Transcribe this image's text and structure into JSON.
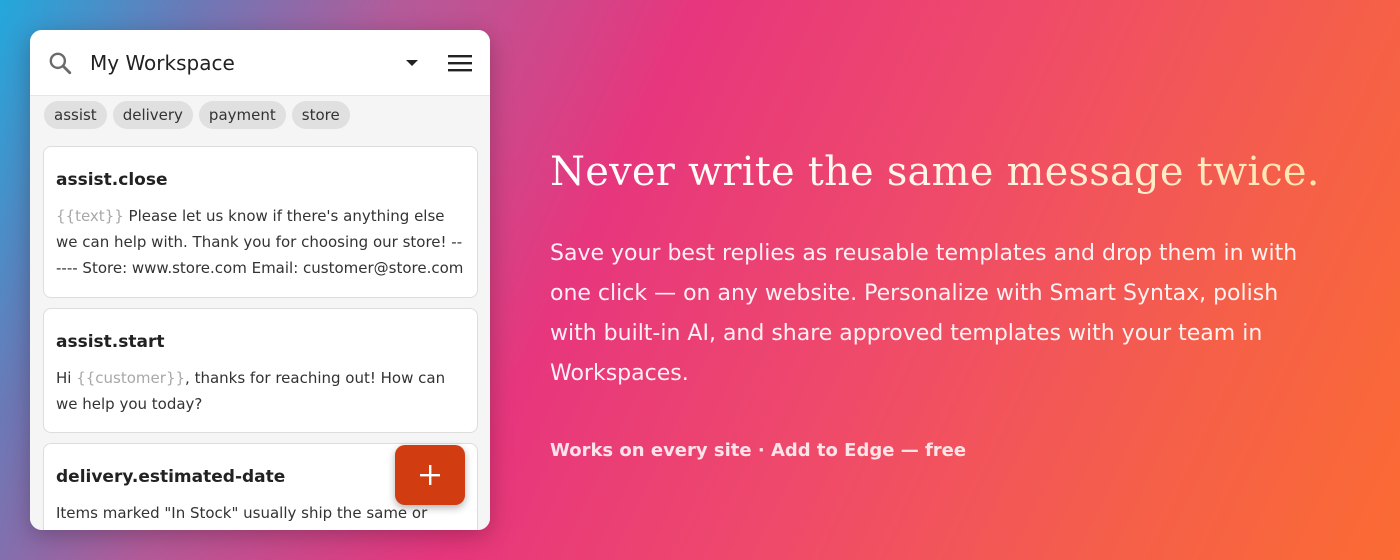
{
  "popup": {
    "header": {
      "workspace_title": "My Workspace",
      "icons": {
        "search": "search-icon",
        "dropdown": "chevron-down-icon",
        "menu": "hamburger-menu-icon"
      }
    },
    "tags": [
      "assist",
      "delivery",
      "payment",
      "store"
    ],
    "templates": [
      {
        "title": "assist.close",
        "body_var": "{{text}}",
        "body_text": " Please let us know if there's anything else we can help with. Thank you for choosing our store! ------ Store: www.store.com Email: customer@store.com"
      },
      {
        "title": "assist.start",
        "body_prefix": "Hi ",
        "body_var": "{{customer}}",
        "body_text": ", thanks for reaching out! How can we help you today?"
      },
      {
        "title": "delivery.estimated-date",
        "body_text": "Items marked \"In Stock\" usually ship the same or"
      }
    ],
    "fab": {
      "label": "+",
      "icon": "plus-icon"
    }
  },
  "hero": {
    "headline": "Never write the same message twice.",
    "description": "Save your best replies as reusable templates and drop them in with one click — on any website. Personalize with Smart Syntax, polish with built-in AI, and share approved templates with your team in Workspaces.",
    "cta": "Works on every site · Add to Edge — free"
  },
  "colors": {
    "fab": "#d13d11",
    "variable_text": "#a8a8a8",
    "chip_bg": "#e0e0e0"
  }
}
